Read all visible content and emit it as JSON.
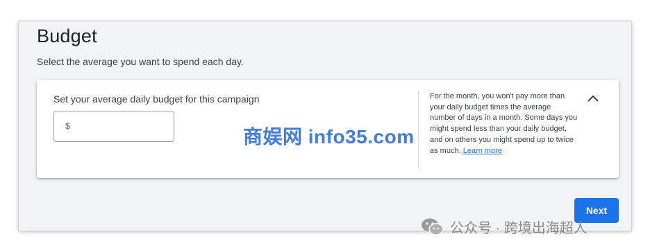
{
  "page": {
    "title": "Budget",
    "subtitle": "Select the average you want to spend each day."
  },
  "budget_card": {
    "label": "Set your average daily budget for this campaign",
    "input": {
      "currency_symbol": "$",
      "value": ""
    },
    "help_text": "For the month, you won't pay more than your daily budget times the average number of days in a month. Some days you might spend less than your daily budget, and on others you might spend up to twice as much.",
    "learn_more_link": "Learn more",
    "collapse_icon": "chevron-up-icon"
  },
  "actions": {
    "next_label": "Next"
  },
  "watermarks": {
    "center": "商娱网 info35.com",
    "wechat": "公众号 · 跨境出海超人",
    "wechat_icon": "wechat-icon"
  },
  "colors": {
    "accent": "#1a73e8",
    "page_background": "#f1f3f4",
    "card_background": "#ffffff",
    "watermark_blue": "#2266dd"
  }
}
